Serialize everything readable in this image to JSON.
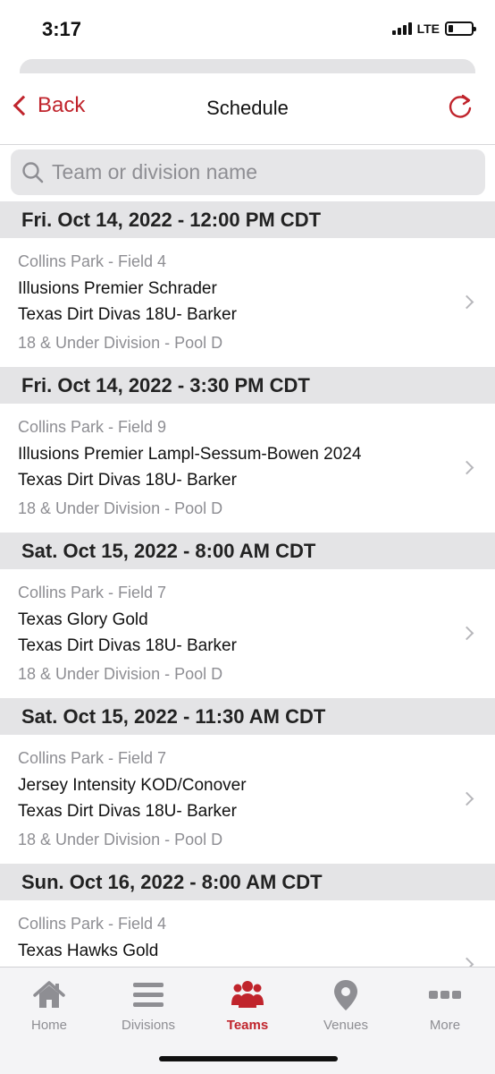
{
  "status_bar": {
    "time": "3:17",
    "network": "LTE"
  },
  "nav": {
    "back_label": "Back",
    "title": "Schedule"
  },
  "search": {
    "placeholder": "Team or division name"
  },
  "groups": [
    {
      "date": "Fri. Oct 14, 2022 - 12:00 PM CDT",
      "game": {
        "venue": "Collins Park - Field 4",
        "team1": "Illusions Premier Schrader",
        "team2": "Texas Dirt Divas 18U- Barker",
        "division": "18 & Under Division - Pool D"
      }
    },
    {
      "date": "Fri. Oct 14, 2022 - 3:30 PM CDT",
      "game": {
        "venue": "Collins Park - Field 9",
        "team1": "Illusions Premier Lampl-Sessum-Bowen 2024",
        "team2": "Texas Dirt Divas 18U- Barker",
        "division": "18 & Under Division - Pool D"
      }
    },
    {
      "date": "Sat. Oct 15, 2022 - 8:00 AM CDT",
      "game": {
        "venue": "Collins Park - Field 7",
        "team1": "Texas Glory Gold",
        "team2": "Texas Dirt Divas 18U- Barker",
        "division": "18 & Under Division - Pool D"
      }
    },
    {
      "date": "Sat. Oct 15, 2022 - 11:30 AM CDT",
      "game": {
        "venue": "Collins Park - Field 7",
        "team1": "Jersey Intensity KOD/Conover",
        "team2": "Texas Dirt Divas 18U- Barker",
        "division": "18 & Under Division - Pool D"
      }
    },
    {
      "date": "Sun. Oct 16, 2022 - 8:00 AM CDT",
      "game": {
        "venue": "Collins Park - Field 4",
        "team1": "Texas Hawks Gold",
        "team2": "",
        "division": ""
      }
    }
  ],
  "tabs": [
    {
      "label": "Home",
      "icon": "home-icon"
    },
    {
      "label": "Divisions",
      "icon": "list-icon"
    },
    {
      "label": "Teams",
      "icon": "people-icon",
      "active": true
    },
    {
      "label": "Venues",
      "icon": "map-pin-icon"
    },
    {
      "label": "More",
      "icon": "more-icon"
    }
  ],
  "colors": {
    "accent": "#c0242c",
    "header_bg": "#e4e4e6",
    "muted_text": "#8e8e93"
  }
}
